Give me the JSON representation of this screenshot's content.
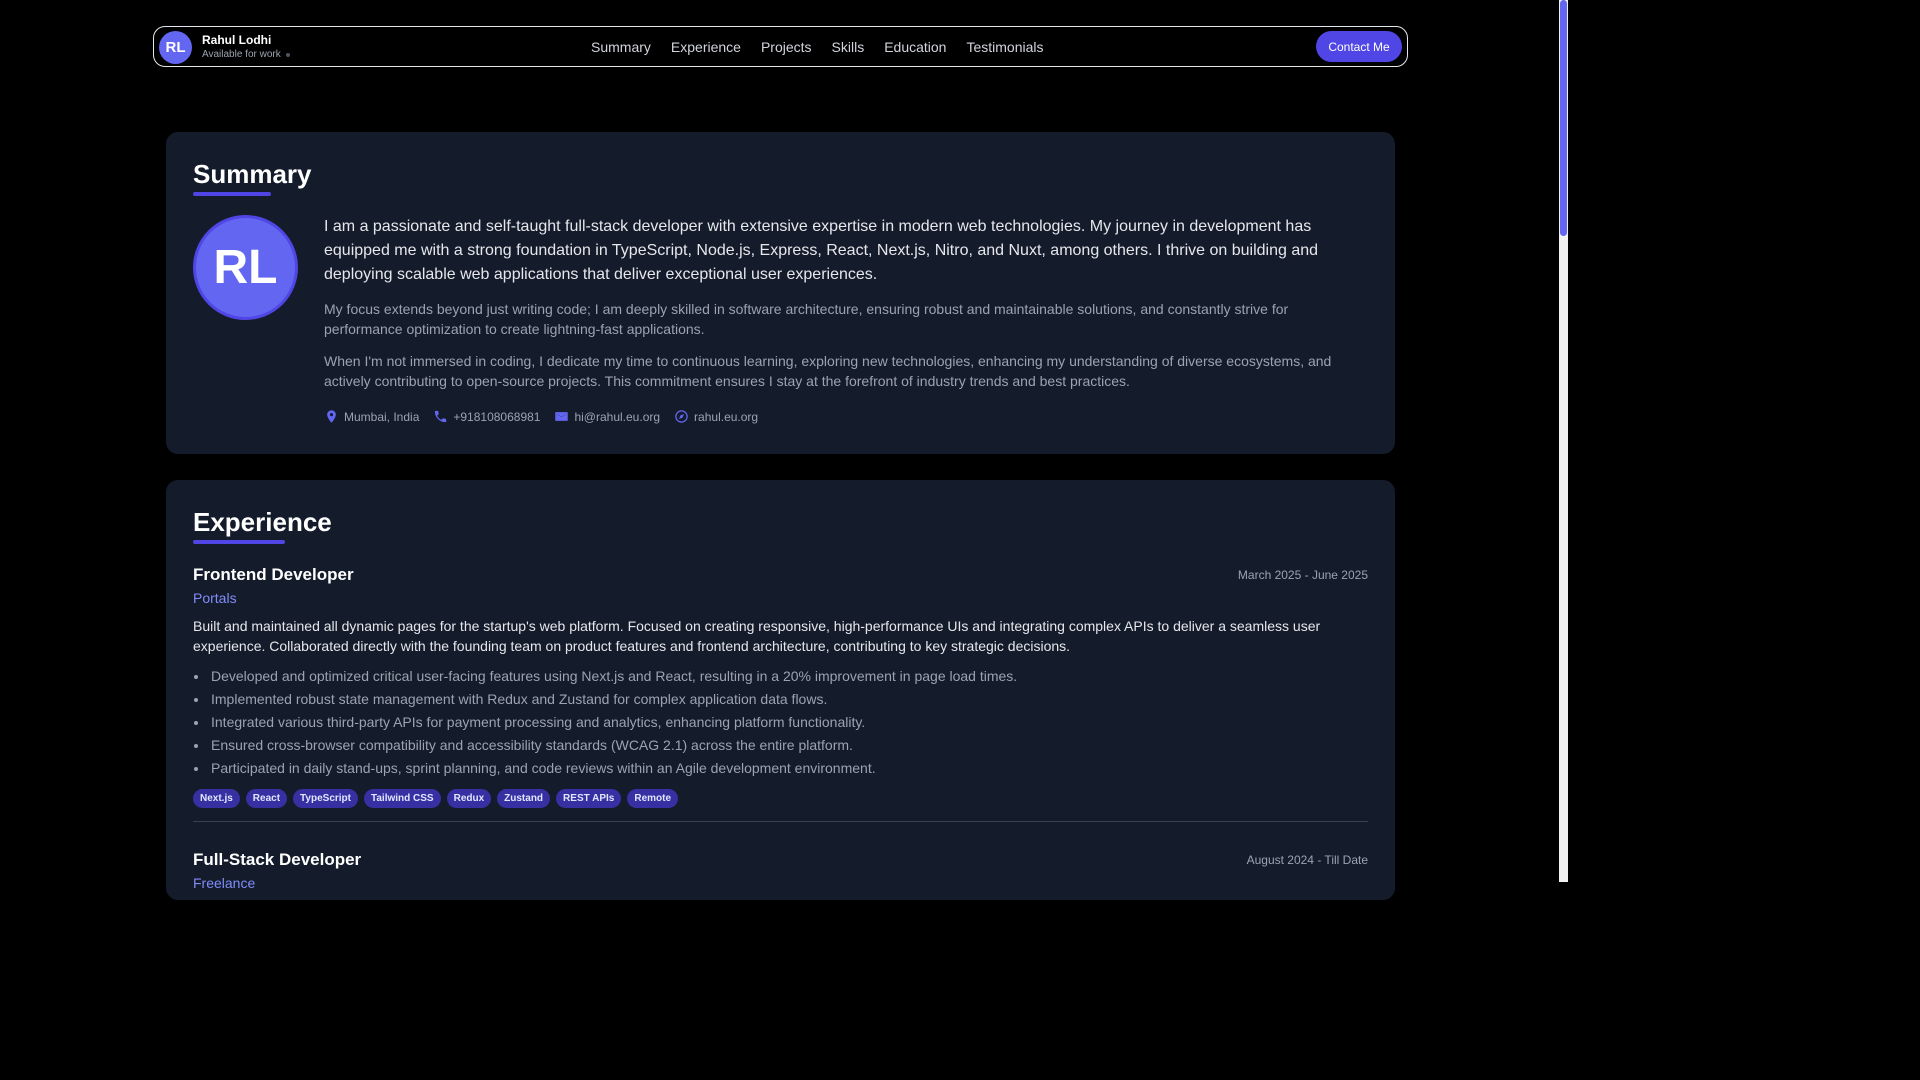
{
  "header": {
    "avatar_initials": "RL",
    "name": "Rahul Lodhi",
    "status": "Available for work",
    "nav": [
      "Summary",
      "Experience",
      "Projects",
      "Skills",
      "Education",
      "Testimonials"
    ],
    "contact_button": "Contact Me"
  },
  "summary": {
    "title": "Summary",
    "avatar_initials": "RL",
    "main": "I am a passionate and self-taught full-stack developer with extensive expertise in modern web technologies. My journey in development has equipped me with a strong foundation in TypeScript, Node.js, Express, React, Next.js, Nitro, and Nuxt, among others. I thrive on building and deploying scalable web applications that deliver exceptional user experiences.",
    "p2": "My focus extends beyond just writing code; I am deeply skilled in software architecture, ensuring robust and maintainable solutions, and constantly strive for performance optimization to create lightning-fast applications.",
    "p3": "When I'm not immersed in coding, I dedicate my time to continuous learning, exploring new technologies, enhancing my understanding of diverse ecosystems, and actively contributing to open-source projects. This commitment ensures I stay at the forefront of industry trends and best practices.",
    "location": "Mumbai, India",
    "phone": "+918108068981",
    "email": "hi@rahul.eu.org",
    "website": "rahul.eu.org"
  },
  "experience": {
    "title": "Experience",
    "jobs": [
      {
        "title": "Frontend Developer",
        "company": "Portals",
        "dates": "March 2025 - June 2025",
        "description": "Built and maintained all dynamic pages for the startup's web platform. Focused on creating responsive, high-performance UIs and integrating complex APIs to deliver a seamless user experience. Collaborated directly with the founding team on product features and frontend architecture, contributing to key strategic decisions.",
        "bullets": [
          "Developed and optimized critical user-facing features using Next.js and React, resulting in a 20% improvement in page load times.",
          "Implemented robust state management with Redux and Zustand for complex application data flows.",
          "Integrated various third-party APIs for payment processing and analytics, enhancing platform functionality.",
          "Ensured cross-browser compatibility and accessibility standards (WCAG 2.1) across the entire platform.",
          "Participated in daily stand-ups, sprint planning, and code reviews within an Agile development environment."
        ],
        "tags": [
          "Next.js",
          "React",
          "TypeScript",
          "Tailwind CSS",
          "Redux",
          "Zustand",
          "REST APIs",
          "Remote"
        ]
      },
      {
        "title": "Full-Stack Developer",
        "company": "Freelance",
        "dates": "August 2024 - Till Date"
      }
    ]
  },
  "colors": {
    "accent": "#4f46e5",
    "card_bg": "#141b2b",
    "page_bg": "#000000"
  }
}
